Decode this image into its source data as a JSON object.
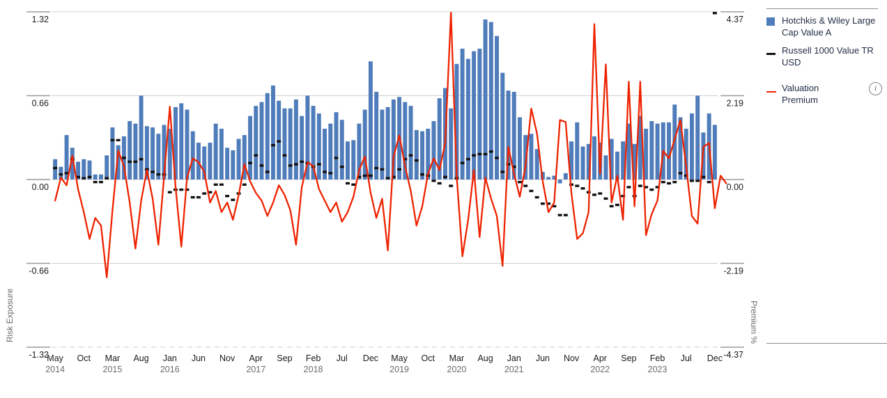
{
  "legend": {
    "items": [
      {
        "label": "Hotchkis & Wiley Large Cap Value A",
        "marker": "square-swatch",
        "color": "#4f7cba"
      },
      {
        "label": "Russell 1000 Value TR USD",
        "marker": "dash-swatch",
        "color": "#111111"
      },
      {
        "label": "Valuation Premium",
        "marker": "line-swatch",
        "color": "#ee2200"
      }
    ],
    "info_icon": "i"
  },
  "chart_data": {
    "type": "bar",
    "title": "",
    "xlabel": "",
    "ylabel": "Risk Exposure",
    "y2label": "Premium %",
    "ylim": [
      -1.32,
      1.32
    ],
    "y2lim": [
      -4.37,
      4.37
    ],
    "yticks": [
      "1.32",
      "0.66",
      "0.00",
      "-0.66",
      "-1.32"
    ],
    "ytick_values": [
      1.32,
      0.66,
      0.0,
      -0.66,
      -1.32
    ],
    "y2ticks": [
      "4.37",
      "2.19",
      "0.00",
      "-2.19",
      "-4.37"
    ],
    "y2tick_values": [
      4.37,
      2.19,
      0.0,
      -2.19,
      -4.37
    ],
    "grid": true,
    "legend_position": "right",
    "xtick_labels": [
      {
        "month": "May",
        "year": "2014"
      },
      {
        "month": "Oct",
        "year": ""
      },
      {
        "month": "Mar",
        "year": "2015"
      },
      {
        "month": "Aug",
        "year": ""
      },
      {
        "month": "Jan",
        "year": "2016"
      },
      {
        "month": "Jun",
        "year": ""
      },
      {
        "month": "Nov",
        "year": ""
      },
      {
        "month": "Apr",
        "year": "2017"
      },
      {
        "month": "Sep",
        "year": ""
      },
      {
        "month": "Feb",
        "year": "2018"
      },
      {
        "month": "Jul",
        "year": ""
      },
      {
        "month": "Dec",
        "year": ""
      },
      {
        "month": "May",
        "year": "2019"
      },
      {
        "month": "Oct",
        "year": ""
      },
      {
        "month": "Mar",
        "year": "2020"
      },
      {
        "month": "Aug",
        "year": ""
      },
      {
        "month": "Jan",
        "year": "2021"
      },
      {
        "month": "Jun",
        "year": ""
      },
      {
        "month": "Nov",
        "year": ""
      },
      {
        "month": "Apr",
        "year": "2022"
      },
      {
        "month": "Sep",
        "year": ""
      },
      {
        "month": "Feb",
        "year": "2023"
      },
      {
        "month": "Jul",
        "year": ""
      },
      {
        "month": "Dec",
        "year": ""
      }
    ],
    "xtick_indices": [
      0,
      5,
      10,
      15,
      20,
      25,
      30,
      35,
      40,
      45,
      50,
      55,
      60,
      65,
      70,
      75,
      80,
      85,
      90,
      95,
      100,
      105,
      110,
      115
    ],
    "series": [
      {
        "name": "Hotchkis & Wiley Large Cap Value A",
        "type": "bar",
        "color": "#4f7cba",
        "axis": "left",
        "values": [
          0.16,
          0.1,
          0.35,
          0.25,
          0.14,
          0.16,
          0.15,
          0.04,
          0.04,
          0.19,
          0.41,
          0.27,
          0.34,
          0.46,
          0.44,
          0.66,
          0.42,
          0.41,
          0.36,
          0.43,
          0.4,
          0.57,
          0.6,
          0.55,
          0.38,
          0.29,
          0.26,
          0.29,
          0.44,
          0.4,
          0.25,
          0.23,
          0.32,
          0.35,
          0.5,
          0.58,
          0.61,
          0.68,
          0.74,
          0.62,
          0.56,
          0.56,
          0.63,
          0.5,
          0.66,
          0.58,
          0.52,
          0.4,
          0.44,
          0.53,
          0.47,
          0.3,
          0.31,
          0.44,
          0.55,
          0.93,
          0.69,
          0.55,
          0.57,
          0.63,
          0.65,
          0.61,
          0.58,
          0.39,
          0.38,
          0.4,
          0.46,
          0.64,
          0.72,
          0.56,
          0.91,
          1.03,
          0.95,
          1.01,
          1.03,
          1.26,
          1.24,
          1.13,
          0.84,
          0.7,
          0.69,
          0.49,
          0.35,
          0.36,
          0.24,
          0.06,
          0.02,
          0.03,
          -0.03,
          0.05,
          0.3,
          0.45,
          0.26,
          0.28,
          0.34,
          0.29,
          0.19,
          0.32,
          0.22,
          0.3,
          0.44,
          0.28,
          0.5,
          0.4,
          0.46,
          0.44,
          0.45,
          0.45,
          0.59,
          0.49,
          0.4,
          0.52,
          0.66,
          0.37,
          0.52,
          0.43
        ]
      },
      {
        "name": "Russell 1000 Value TR USD",
        "type": "dash",
        "color": "#111111",
        "axis": "left",
        "values": [
          0.09,
          0.04,
          0.05,
          0.16,
          0.02,
          0.01,
          0.02,
          -0.02,
          -0.02,
          0.01,
          0.31,
          0.31,
          0.17,
          0.14,
          0.14,
          0.16,
          0.08,
          0.06,
          0.04,
          0.04,
          -0.1,
          -0.08,
          -0.08,
          -0.08,
          -0.14,
          -0.14,
          -0.11,
          -0.1,
          -0.04,
          -0.04,
          -0.13,
          -0.16,
          -0.11,
          -0.04,
          0.13,
          0.19,
          0.11,
          0.06,
          0.27,
          0.3,
          0.19,
          0.11,
          0.12,
          0.14,
          0.13,
          0.1,
          0.12,
          0.06,
          0.05,
          0.17,
          0.1,
          -0.03,
          -0.04,
          0.02,
          0.03,
          0.03,
          0.09,
          0.08,
          0.01,
          0.02,
          0.08,
          0.16,
          0.19,
          0.15,
          0.04,
          0.03,
          -0.01,
          -0.03,
          0.02,
          -0.05,
          0.01,
          0.13,
          0.16,
          0.19,
          0.2,
          0.2,
          0.22,
          0.17,
          0.06,
          0.12,
          0.1,
          -0.02,
          -0.05,
          -0.09,
          -0.14,
          -0.19,
          -0.19,
          -0.21,
          -0.28,
          -0.28,
          -0.04,
          -0.05,
          -0.07,
          -0.1,
          -0.12,
          -0.11,
          -0.15,
          -0.21,
          -0.2,
          -0.13,
          -0.06,
          -0.13,
          -0.05,
          -0.06,
          -0.08,
          -0.06,
          -0.02,
          -0.03,
          -0.02,
          0.05,
          0.03,
          -0.01,
          -0.01,
          0.02,
          -0.02,
          1.31
        ]
      },
      {
        "name": "Valuation Premium",
        "type": "line",
        "color": "#ee2200",
        "axis": "right",
        "values": [
          -0.55,
          0.05,
          -0.15,
          0.62,
          -0.25,
          -0.85,
          -1.55,
          -1.0,
          -1.2,
          -2.55,
          -0.8,
          0.75,
          0.35,
          -0.6,
          -1.8,
          -0.55,
          0.25,
          -0.5,
          -1.7,
          0.1,
          1.9,
          -0.2,
          -1.75,
          0.05,
          0.55,
          0.45,
          0.2,
          -0.6,
          -0.3,
          -0.85,
          -0.6,
          -1.05,
          -0.4,
          0.4,
          -0.05,
          -0.35,
          -0.55,
          -0.95,
          -0.6,
          -0.15,
          -0.4,
          -0.8,
          -1.7,
          -0.2,
          0.45,
          0.35,
          -0.25,
          -0.55,
          -0.85,
          -0.6,
          -1.1,
          -0.85,
          -0.45,
          0.25,
          0.6,
          -0.35,
          -1.0,
          -0.5,
          -1.85,
          0.6,
          1.15,
          0.35,
          -0.3,
          -1.2,
          -0.7,
          0.15,
          0.55,
          0.25,
          0.95,
          4.35,
          0.1,
          -2.0,
          -1.05,
          0.25,
          -1.5,
          0.05,
          -0.5,
          -0.95,
          -2.25,
          0.85,
          0.15,
          -0.45,
          0.35,
          1.85,
          1.2,
          -0.05,
          -0.85,
          -0.6,
          1.55,
          1.5,
          -0.35,
          -1.55,
          -1.4,
          -0.85,
          4.05,
          0.15,
          3.0,
          -0.6,
          0.1,
          -1.05,
          2.55,
          -0.7,
          2.55,
          -1.45,
          -0.9,
          -0.55,
          0.75,
          0.55,
          1.05,
          1.55,
          0.35,
          -0.95,
          -1.15,
          0.85,
          0.95,
          -0.75,
          0.1,
          -0.1
        ]
      }
    ]
  }
}
